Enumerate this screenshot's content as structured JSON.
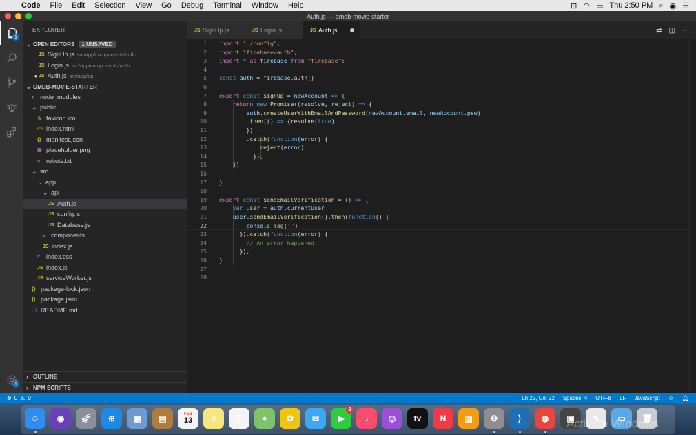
{
  "menubar": {
    "app_name": "Code",
    "items": [
      "File",
      "Edit",
      "Selection",
      "View",
      "Go",
      "Debug",
      "Terminal",
      "Window",
      "Help"
    ],
    "clock": "Thu 2:50 PM",
    "colors": {
      "bg": "#e8e8e8"
    }
  },
  "window": {
    "title": "Auth.js — omdb-movie-starter"
  },
  "activity_bar": {
    "explorer_badge": "1",
    "settings_badge": "1"
  },
  "sidebar": {
    "title": "EXPLORER",
    "open_editors": {
      "label": "OPEN EDITORS",
      "unsaved_badge": "1 UNSAVED",
      "files": [
        {
          "icon": "JS",
          "name": "SignUp.js",
          "path": "src/app/components/auth",
          "modified": false
        },
        {
          "icon": "JS",
          "name": "Login.js",
          "path": "src/app/components/auth",
          "modified": false
        },
        {
          "icon": "JS",
          "name": "Auth.js",
          "path": "src/app/api",
          "modified": true
        }
      ]
    },
    "project": {
      "label": "OMDB-MOVIE-STARTER",
      "tree": [
        {
          "name": "node_modules",
          "type": "folder",
          "open": false,
          "depth": 0
        },
        {
          "name": "public",
          "type": "folder",
          "open": true,
          "depth": 0
        },
        {
          "name": "favicon.ico",
          "type": "file",
          "icon": "☆",
          "kind": "fav",
          "depth": 1
        },
        {
          "name": "index.html",
          "type": "file",
          "icon": "<>",
          "kind": "html",
          "depth": 1
        },
        {
          "name": "manifest.json",
          "type": "file",
          "icon": "{}",
          "kind": "json",
          "depth": 1
        },
        {
          "name": "placeholder.png",
          "type": "file",
          "icon": "▣",
          "kind": "img",
          "depth": 1
        },
        {
          "name": "robots.txt",
          "type": "file",
          "icon": "≡",
          "kind": "txt",
          "depth": 1
        },
        {
          "name": "src",
          "type": "folder",
          "open": true,
          "depth": 0
        },
        {
          "name": "app",
          "type": "folder",
          "open": true,
          "depth": 1
        },
        {
          "name": "api",
          "type": "folder",
          "open": true,
          "depth": 2
        },
        {
          "name": "Auth.js",
          "type": "file",
          "icon": "JS",
          "kind": "js",
          "depth": 3,
          "selected": true
        },
        {
          "name": "config.js",
          "type": "file",
          "icon": "JS",
          "kind": "js",
          "depth": 3
        },
        {
          "name": "Database.js",
          "type": "file",
          "icon": "JS",
          "kind": "js",
          "depth": 3
        },
        {
          "name": "components",
          "type": "folder",
          "open": false,
          "depth": 2
        },
        {
          "name": "index.js",
          "type": "file",
          "icon": "JS",
          "kind": "js",
          "depth": 2
        },
        {
          "name": "index.css",
          "type": "file",
          "icon": "#",
          "kind": "css",
          "depth": 1
        },
        {
          "name": "index.js",
          "type": "file",
          "icon": "JS",
          "kind": "js",
          "depth": 1
        },
        {
          "name": "serviceWorker.js",
          "type": "file",
          "icon": "JS",
          "kind": "js",
          "depth": 1
        },
        {
          "name": "package-lock.json",
          "type": "file",
          "icon": "{}",
          "kind": "json",
          "depth": 0
        },
        {
          "name": "package.json",
          "type": "file",
          "icon": "{}",
          "kind": "json",
          "depth": 0
        },
        {
          "name": "README.md",
          "type": "file",
          "icon": "ⓘ",
          "kind": "info",
          "depth": 0
        }
      ]
    },
    "outline_label": "OUTLINE",
    "npm_label": "NPM SCRIPTS"
  },
  "tabs": [
    {
      "icon": "JS",
      "label": "SignUp.js",
      "active": false,
      "modified": false
    },
    {
      "icon": "JS",
      "label": "Login.js",
      "active": false,
      "modified": false
    },
    {
      "icon": "JS",
      "label": "Auth.js",
      "active": true,
      "modified": true
    }
  ],
  "editor": {
    "current_line": 22,
    "lines": [
      [
        [
          "k",
          "import"
        ],
        [
          "p",
          " "
        ],
        [
          "s",
          "\"./config\""
        ],
        [
          "p",
          ";"
        ]
      ],
      [
        [
          "k",
          "import"
        ],
        [
          "p",
          " "
        ],
        [
          "s",
          "\"firebase/auth\""
        ],
        [
          "p",
          ";"
        ]
      ],
      [
        [
          "k",
          "import"
        ],
        [
          "p",
          " "
        ],
        [
          "b",
          "*"
        ],
        [
          "p",
          " "
        ],
        [
          "k",
          "as"
        ],
        [
          "p",
          " "
        ],
        [
          "v",
          "firebase"
        ],
        [
          "p",
          " "
        ],
        [
          "k",
          "from"
        ],
        [
          "p",
          " "
        ],
        [
          "s",
          "\"firebase\""
        ],
        [
          "p",
          ";"
        ]
      ],
      [],
      [
        [
          "b",
          "const"
        ],
        [
          "p",
          " "
        ],
        [
          "v",
          "auth"
        ],
        [
          "p",
          " = "
        ],
        [
          "v",
          "firebase"
        ],
        [
          "p",
          "."
        ],
        [
          "f",
          "auth"
        ],
        [
          "p",
          "()"
        ]
      ],
      [],
      [
        [
          "k",
          "export"
        ],
        [
          "p",
          " "
        ],
        [
          "b",
          "const"
        ],
        [
          "p",
          " "
        ],
        [
          "f",
          "signUp"
        ],
        [
          "p",
          " = "
        ],
        [
          "v",
          "newAccount"
        ],
        [
          "p",
          " "
        ],
        [
          "b",
          "=>"
        ],
        [
          "p",
          " {"
        ]
      ],
      [
        [
          "p",
          "    "
        ],
        [
          "k",
          "return"
        ],
        [
          "p",
          " "
        ],
        [
          "b",
          "new"
        ],
        [
          "p",
          " "
        ],
        [
          "f",
          "Promise"
        ],
        [
          "p",
          "(("
        ],
        [
          "v",
          "resolve"
        ],
        [
          "p",
          ", "
        ],
        [
          "v",
          "reject"
        ],
        [
          "p",
          ") "
        ],
        [
          "b",
          "=>"
        ],
        [
          "p",
          " {"
        ]
      ],
      [
        [
          "p",
          "        "
        ],
        [
          "v",
          "auth"
        ],
        [
          "p",
          "."
        ],
        [
          "f",
          "createUserWithEmailAndPassword"
        ],
        [
          "p",
          "("
        ],
        [
          "v",
          "newAccount"
        ],
        [
          "p",
          "."
        ],
        [
          "v",
          "email"
        ],
        [
          "p",
          ", "
        ],
        [
          "v",
          "newAccount"
        ],
        [
          "p",
          "."
        ],
        [
          "v",
          "psw"
        ],
        [
          "p",
          ")"
        ]
      ],
      [
        [
          "p",
          "        ."
        ],
        [
          "f",
          "then"
        ],
        [
          "p",
          "(() "
        ],
        [
          "b",
          "=>"
        ],
        [
          "p",
          " {"
        ],
        [
          "f",
          "resolve"
        ],
        [
          "p",
          "("
        ],
        [
          "b",
          "true"
        ],
        [
          "p",
          ")"
        ]
      ],
      [
        [
          "p",
          "        })"
        ]
      ],
      [
        [
          "p",
          "        ."
        ],
        [
          "f",
          "catch"
        ],
        [
          "p",
          "("
        ],
        [
          "b",
          "function"
        ],
        [
          "p",
          "("
        ],
        [
          "v",
          "error"
        ],
        [
          "p",
          ") {"
        ]
      ],
      [
        [
          "p",
          "            "
        ],
        [
          "f",
          "reject"
        ],
        [
          "p",
          "("
        ],
        [
          "v",
          "error"
        ],
        [
          "p",
          ")"
        ]
      ],
      [
        [
          "p",
          "          });"
        ]
      ],
      [
        [
          "p",
          "    })"
        ]
      ],
      [],
      [
        [
          "p",
          "}"
        ]
      ],
      [],
      [
        [
          "k",
          "export"
        ],
        [
          "p",
          " "
        ],
        [
          "b",
          "const"
        ],
        [
          "p",
          " "
        ],
        [
          "f",
          "sendEmailVerification"
        ],
        [
          "p",
          " = () "
        ],
        [
          "b",
          "=>"
        ],
        [
          "p",
          " {"
        ]
      ],
      [
        [
          "p",
          "    "
        ],
        [
          "b",
          "var"
        ],
        [
          "p",
          " "
        ],
        [
          "v",
          "user"
        ],
        [
          "p",
          " = "
        ],
        [
          "v",
          "auth"
        ],
        [
          "p",
          "."
        ],
        [
          "v",
          "currentUser"
        ]
      ],
      [
        [
          "p",
          "    "
        ],
        [
          "v",
          "user"
        ],
        [
          "p",
          "."
        ],
        [
          "f",
          "sendEmailVerification"
        ],
        [
          "p",
          "()."
        ],
        [
          "f",
          "then"
        ],
        [
          "p",
          "("
        ],
        [
          "b",
          "function"
        ],
        [
          "p",
          "() {"
        ]
      ],
      [
        [
          "p",
          "        "
        ],
        [
          "v",
          "console"
        ],
        [
          "p",
          "."
        ],
        [
          "f",
          "log"
        ],
        [
          "p",
          "("
        ],
        [
          "s",
          "'"
        ],
        [
          "cursor",
          ""
        ],
        [
          "s",
          "'"
        ],
        [
          "p",
          ")"
        ]
      ],
      [
        [
          "p",
          "      })."
        ],
        [
          "f",
          "catch"
        ],
        [
          "p",
          "("
        ],
        [
          "b",
          "function"
        ],
        [
          "p",
          "("
        ],
        [
          "v",
          "error"
        ],
        [
          "p",
          ") {"
        ]
      ],
      [
        [
          "p",
          "        "
        ],
        [
          "c",
          "// An error happened."
        ]
      ],
      [
        [
          "p",
          "      });"
        ]
      ],
      [
        [
          "p",
          "}"
        ]
      ],
      [],
      []
    ]
  },
  "status": {
    "errors": "0",
    "warnings": "0",
    "position": "Ln 22, Col 22",
    "spaces": "Spaces: 4",
    "encoding": "UTF-8",
    "eol": "LF",
    "language": "JavaScript",
    "colors": {
      "bg": "#007acc"
    }
  },
  "dock": {
    "calendar_day": "13",
    "calendar_month": "FEB",
    "facetime_badge": "2",
    "tv_label": "tv",
    "apps": [
      {
        "icon": "finder-icon",
        "color": "#2f8cf0",
        "running": true
      },
      {
        "icon": "siri-icon",
        "color": "#6b3fb8",
        "running": false
      },
      {
        "icon": "launchpad-icon",
        "color": "#8a8f99",
        "running": false
      },
      {
        "icon": "safari-icon",
        "color": "#1e88e5",
        "running": false
      },
      {
        "icon": "preview-icon",
        "color": "#6b9bd1",
        "running": false
      },
      {
        "icon": "notefile-icon",
        "color": "#b07b3e",
        "running": false
      },
      {
        "icon": "calendar-icon",
        "color": "#f4f4f4",
        "running": false
      },
      {
        "icon": "notes-icon",
        "color": "#f7e57d",
        "running": false
      },
      {
        "icon": "reminders-icon",
        "color": "#f4f4f4",
        "running": false
      },
      {
        "icon": "maps-icon",
        "color": "#7cc36a",
        "running": false
      },
      {
        "icon": "photos-icon",
        "color": "#f1c40f",
        "running": false
      },
      {
        "icon": "messages-icon",
        "color": "#3ba7f5",
        "running": false
      },
      {
        "icon": "facetime-icon",
        "color": "#2ecc40",
        "running": false
      },
      {
        "icon": "music-icon",
        "color": "#f94c6f",
        "running": false
      },
      {
        "icon": "podcasts-icon",
        "color": "#9b4fd8",
        "running": false
      },
      {
        "icon": "tv-icon",
        "color": "#111111",
        "running": false
      },
      {
        "icon": "news-icon",
        "color": "#f03a47",
        "running": false
      },
      {
        "icon": "books-icon",
        "color": "#f39c12",
        "running": false
      },
      {
        "icon": "system-preferences-icon",
        "color": "#8d8d92",
        "running": true
      },
      {
        "icon": "vscode-icon",
        "color": "#1f6fb5",
        "running": true
      },
      {
        "icon": "chrome-icon",
        "color": "#e8453c",
        "running": true
      },
      {
        "icon": "photo-booth-icon",
        "color": "#444444",
        "running": false
      },
      {
        "icon": "text-edit-icon",
        "color": "#e8e8e8",
        "running": false
      },
      {
        "icon": "downloads-folder-icon",
        "color": "#5aa9e6",
        "running": false
      },
      {
        "icon": "trash-icon",
        "color": "#c8ccd0",
        "running": false
      }
    ]
  }
}
